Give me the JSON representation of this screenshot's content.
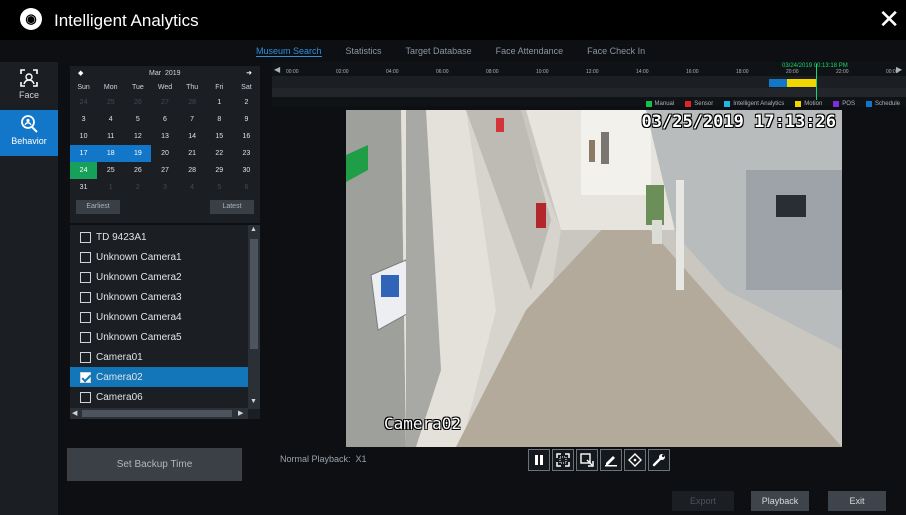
{
  "window": {
    "title": "Intelligent Analytics",
    "close_label": "✕"
  },
  "tabs": [
    {
      "label": "Museum Search",
      "active": true
    },
    {
      "label": "Statistics",
      "active": false
    },
    {
      "label": "Target Database",
      "active": false
    },
    {
      "label": "Face Attendance",
      "active": false
    },
    {
      "label": "Face Check In",
      "active": false
    }
  ],
  "sidebar": [
    {
      "label": "Face",
      "icon": "face-scan-icon",
      "active": false
    },
    {
      "label": "Behavior",
      "icon": "behavior-search-icon",
      "active": true
    }
  ],
  "calendar": {
    "prev_label": "◆",
    "next_label": "➜",
    "month": "Mar",
    "year": "2019",
    "weekdays": [
      "Sun",
      "Mon",
      "Tue",
      "Wed",
      "Thu",
      "Fri",
      "Sat"
    ],
    "days": [
      {
        "d": "24",
        "out": true
      },
      {
        "d": "25",
        "out": true
      },
      {
        "d": "26",
        "out": true
      },
      {
        "d": "27",
        "out": true
      },
      {
        "d": "28",
        "out": true
      },
      {
        "d": "1"
      },
      {
        "d": "2"
      },
      {
        "d": "3"
      },
      {
        "d": "4"
      },
      {
        "d": "5"
      },
      {
        "d": "6"
      },
      {
        "d": "7"
      },
      {
        "d": "8"
      },
      {
        "d": "9"
      },
      {
        "d": "10"
      },
      {
        "d": "11"
      },
      {
        "d": "12"
      },
      {
        "d": "13"
      },
      {
        "d": "14"
      },
      {
        "d": "15"
      },
      {
        "d": "16"
      },
      {
        "d": "17",
        "rec": true
      },
      {
        "d": "18",
        "rec": true
      },
      {
        "d": "19",
        "rec": true
      },
      {
        "d": "20"
      },
      {
        "d": "21"
      },
      {
        "d": "22"
      },
      {
        "d": "23"
      },
      {
        "d": "24",
        "sel": true
      },
      {
        "d": "25"
      },
      {
        "d": "26"
      },
      {
        "d": "27"
      },
      {
        "d": "28"
      },
      {
        "d": "29"
      },
      {
        "d": "30"
      },
      {
        "d": "31"
      },
      {
        "d": "1",
        "out": true
      },
      {
        "d": "2",
        "out": true
      },
      {
        "d": "3",
        "out": true
      },
      {
        "d": "4",
        "out": true
      },
      {
        "d": "5",
        "out": true
      },
      {
        "d": "6",
        "out": true
      }
    ],
    "earliest_label": "Earliest",
    "latest_label": "Latest"
  },
  "cameras": [
    {
      "name": "TD 9423A1",
      "checked": false
    },
    {
      "name": "Unknown Camera1",
      "checked": false
    },
    {
      "name": "Unknown Camera2",
      "checked": false
    },
    {
      "name": "Unknown Camera3",
      "checked": false
    },
    {
      "name": "Unknown Camera4",
      "checked": false
    },
    {
      "name": "Unknown Camera5",
      "checked": false
    },
    {
      "name": "Camera01",
      "checked": false
    },
    {
      "name": "Camera02",
      "checked": true
    },
    {
      "name": "Camera06",
      "checked": false
    }
  ],
  "backup_label": "Set Backup Time",
  "timeline": {
    "ticks": [
      "00:00",
      "02:00",
      "04:00",
      "06:00",
      "08:00",
      "10:00",
      "12:00",
      "14:00",
      "16:00",
      "18:00",
      "20:00",
      "22:00",
      "00:00"
    ],
    "current_stamp": "03/24/2019 00:13:18 PM",
    "legend": [
      {
        "label": "Manual",
        "color": "#16c24a"
      },
      {
        "label": "Sensor",
        "color": "#e0242a"
      },
      {
        "label": "Intelligent Analytics",
        "color": "#22b5e6"
      },
      {
        "label": "Motion",
        "color": "#f1d600"
      },
      {
        "label": "POS",
        "color": "#7a2fe0"
      },
      {
        "label": "Schedule",
        "color": "#1276c9"
      }
    ]
  },
  "video": {
    "osd_time": "03/25/2019 17:13:26",
    "osd_camera": "Camera02"
  },
  "playback": {
    "status_label": "Normal Playback:",
    "speed": "X1"
  },
  "buttons": {
    "export": "Export",
    "playback": "Playback",
    "exit": "Exit"
  }
}
